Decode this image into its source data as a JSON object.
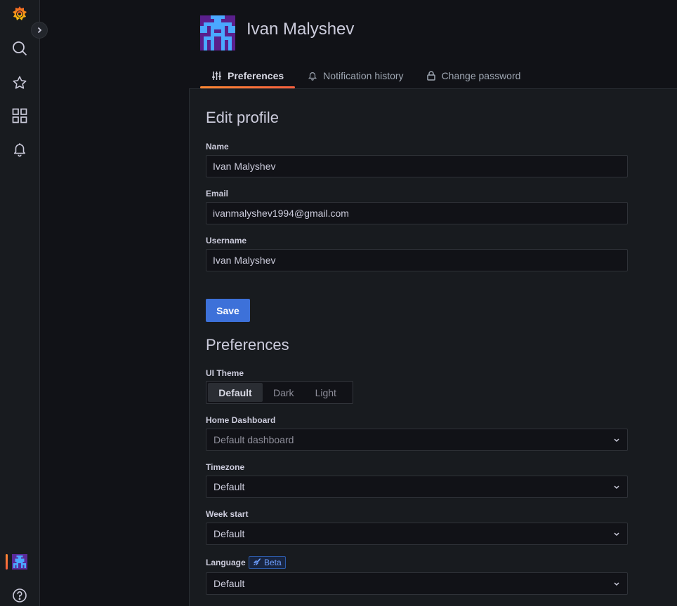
{
  "header": {
    "title": "Ivan Malyshev"
  },
  "tabs": [
    {
      "label": "Preferences",
      "icon": "sliders-icon",
      "active": true
    },
    {
      "label": "Notification history",
      "icon": "bell-icon",
      "active": false
    },
    {
      "label": "Change password",
      "icon": "lock-icon",
      "active": false
    }
  ],
  "profile": {
    "heading": "Edit profile",
    "name_label": "Name",
    "name_value": "Ivan Malyshev",
    "email_label": "Email",
    "email_value": "ivanmalyshev1994@gmail.com",
    "username_label": "Username",
    "username_value": "Ivan Malyshev",
    "save_label": "Save"
  },
  "preferences": {
    "heading": "Preferences",
    "theme_label": "UI Theme",
    "theme_options": [
      "Default",
      "Dark",
      "Light"
    ],
    "theme_selected": "Default",
    "home_label": "Home Dashboard",
    "home_placeholder": "Default dashboard",
    "timezone_label": "Timezone",
    "timezone_value": "Default",
    "weekstart_label": "Week start",
    "weekstart_value": "Default",
    "language_label": "Language",
    "language_badge": "Beta",
    "language_value": "Default"
  },
  "sidebar": {
    "items": [
      "grafana-logo-icon",
      "search-icon",
      "star-icon",
      "dashboards-icon",
      "alerting-bell-icon",
      "user-avatar",
      "help-icon"
    ]
  },
  "colors": {
    "accent_gradient_start": "#ff8833",
    "accent_gradient_end": "#f55f3e",
    "primary_button": "#3d71d9",
    "background": "#111217",
    "panel": "#181b1f"
  }
}
